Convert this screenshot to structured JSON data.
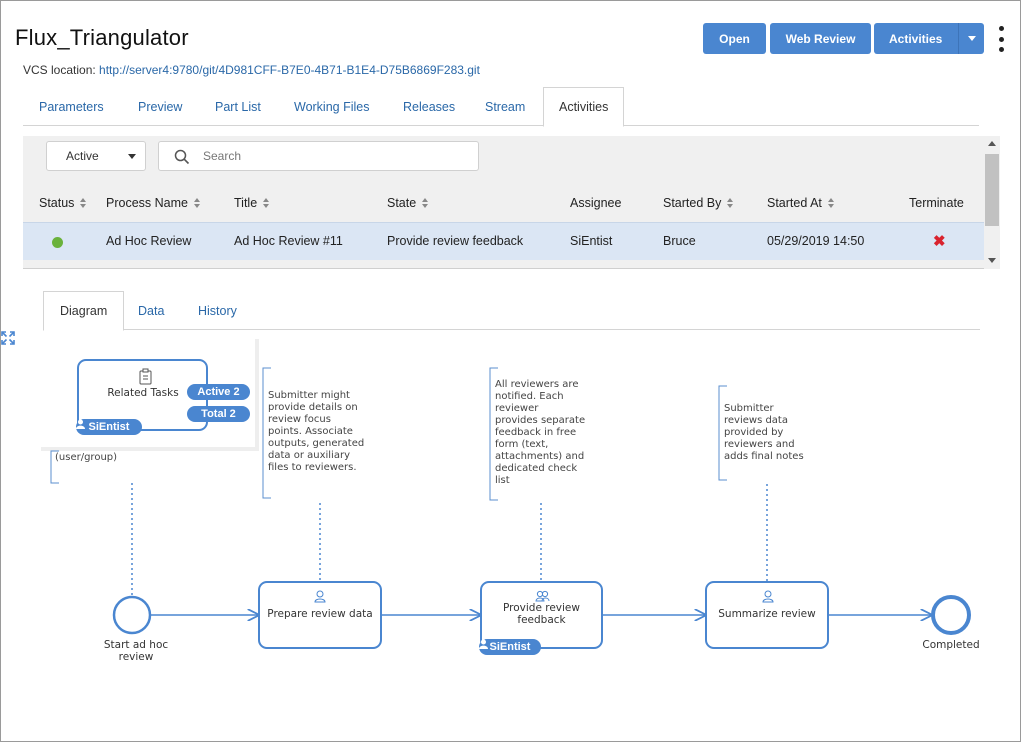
{
  "header": {
    "title": "Flux_Triangulator",
    "vcs_label": "VCS location:",
    "vcs_url": "http://server4:9780/git/4D981CFF-B7E0-4B71-B1E4-D75B6869F283.git"
  },
  "toolbar": {
    "open_label": "Open",
    "web_review_label": "Web Review",
    "activities_label": "Activities"
  },
  "tabs": [
    "Parameters",
    "Preview",
    "Part List",
    "Working Files",
    "Releases",
    "Stream",
    "Activities"
  ],
  "active_tab": "Activities",
  "filter": {
    "status_value": "Active",
    "search_placeholder": "Search"
  },
  "table": {
    "columns": [
      "Status",
      "Process Name",
      "Title",
      "State",
      "Assignee",
      "Started By",
      "Started At",
      "Terminate"
    ],
    "rows": [
      {
        "status": "active",
        "process_name": "Ad Hoc Review",
        "title": "Ad Hoc Review #11",
        "state": "Provide review feedback",
        "assignee": "SiEntist",
        "started_by": "Bruce",
        "started_at": "05/29/2019 14:50"
      }
    ]
  },
  "subtabs": [
    "Diagram",
    "Data",
    "History"
  ],
  "active_subtab": "Diagram",
  "diagram": {
    "related_tasks": {
      "label": "Related Tasks",
      "active_badge": "Active 2",
      "total_badge": "Total 2",
      "user_badge": "SiEntist",
      "note": "(user/group)"
    },
    "annotations": {
      "a1": [
        "Submitter might",
        "provide details on",
        "review focus",
        "points. Associate",
        "outputs, generated",
        "data or auxiliary",
        "files to reviewers."
      ],
      "a2": [
        "All reviewers are",
        "notified. Each",
        "reviewer",
        "provides separate",
        "feedback in free",
        "form (text,",
        "attachments) and",
        "dedicated check",
        "list"
      ],
      "a3": [
        "Submitter",
        "reviews data",
        "provided by",
        "reviewers and",
        "adds final notes"
      ]
    },
    "nodes": {
      "start": [
        "Start ad hoc",
        "review"
      ],
      "prepare": "Prepare review data",
      "provide": [
        "Provide review",
        "feedback"
      ],
      "provide_badge": "SiEntist",
      "summarize": "Summarize review",
      "end": "Completed"
    }
  },
  "colors": {
    "accent": "#4a86d0",
    "status_active": "#6ab23b",
    "terminate": "#d9232e",
    "selected_row": "#dbe6f4"
  },
  "icons": [
    "search-icon",
    "kebab-menu-icon",
    "clipboard-icon",
    "user-icon",
    "group-icon",
    "terminate-x-icon",
    "expand-icon"
  ]
}
